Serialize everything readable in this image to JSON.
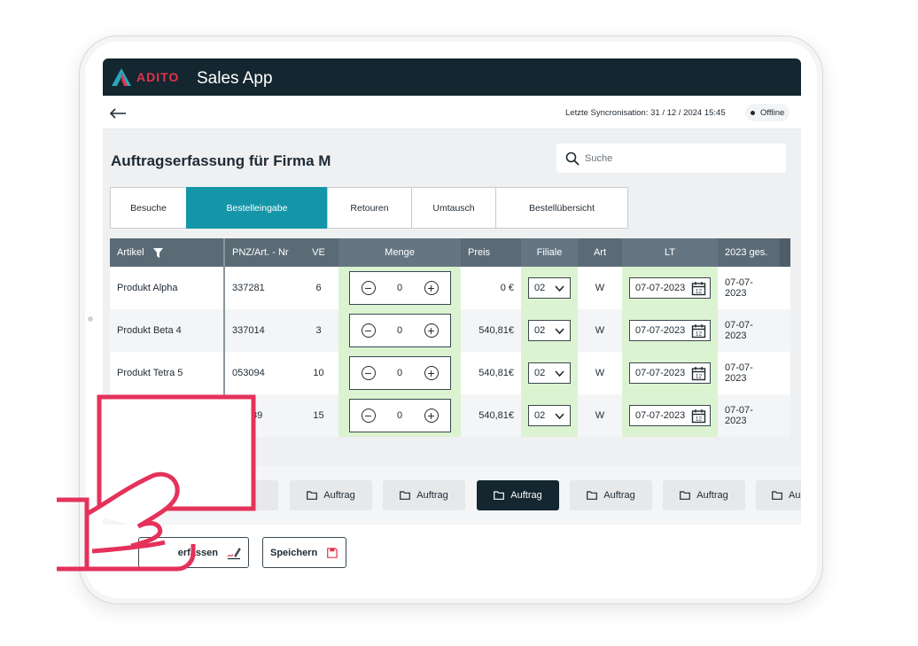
{
  "app": {
    "brand": "ADITO",
    "title": "Sales App"
  },
  "subbar": {
    "back_icon": "arrow-left-icon",
    "sync_text": "Letzte Syncronisation: 31 / 12 / 2024  15:45",
    "status": "Offline"
  },
  "page": {
    "title": "Auftragserfassung für Firma M",
    "search_placeholder": "Suche"
  },
  "tabs": [
    {
      "label": "Besuche",
      "active": false
    },
    {
      "label": "Bestelleingabe",
      "active": true
    },
    {
      "label": "Retouren",
      "active": false
    },
    {
      "label": "Umtausch",
      "active": false
    },
    {
      "label": "Bestellübersicht",
      "active": false
    }
  ],
  "table": {
    "columns": [
      "Artikel",
      "PNZ/Art. - Nr",
      "VE",
      "Menge",
      "Preis",
      "Filiale",
      "Art",
      "LT",
      "2023 ges."
    ],
    "rows": [
      {
        "artikel": "Produkt Alpha",
        "pnz": "337281",
        "ve": "6",
        "menge": "0",
        "preis": "0 €",
        "filiale": "02",
        "art": "W",
        "lt": "07-07-2023",
        "ges": "07-07-2023"
      },
      {
        "artikel": "Produkt Beta 4",
        "pnz": "337014",
        "ve": "3",
        "menge": "0",
        "preis": "540,81€",
        "filiale": "02",
        "art": "W",
        "lt": "07-07-2023",
        "ges": "07-07-2023"
      },
      {
        "artikel": "Produkt Tetra 5",
        "pnz": "053094",
        "ve": "10",
        "menge": "0",
        "preis": "540,81€",
        "filiale": "02",
        "art": "W",
        "lt": "07-07-2023",
        "ges": "07-07-2023"
      },
      {
        "artikel": "",
        "pnz": "89",
        "ve": "15",
        "menge": "0",
        "preis": "540,81€",
        "filiale": "02",
        "art": "W",
        "lt": "07-07-2023",
        "ges": "07-07-2023"
      }
    ]
  },
  "orders": [
    {
      "label": "ag",
      "active": false
    },
    {
      "label": "Auftrag",
      "active": false
    },
    {
      "label": "Auftrag",
      "active": false
    },
    {
      "label": "Auftrag",
      "active": true
    },
    {
      "label": "Auftrag",
      "active": false
    },
    {
      "label": "Auftrag",
      "active": false
    },
    {
      "label": "Au",
      "active": false
    }
  ],
  "actions": {
    "erfassen_label": "erfassen",
    "save_label": "Speichern"
  },
  "colors": {
    "titlebar": "#14262f",
    "accent": "#1596a8",
    "brand_red": "#e4324b",
    "highlight_column": "#dcf3d1"
  }
}
